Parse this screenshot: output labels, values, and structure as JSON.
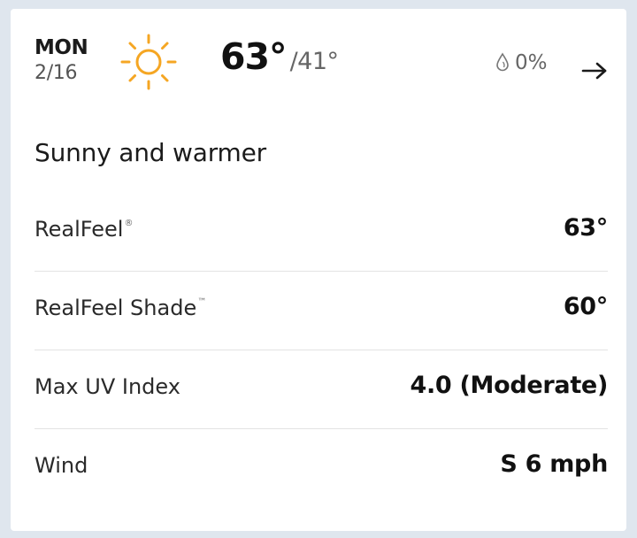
{
  "forecast": {
    "day": "MON",
    "date": "2/16",
    "icon": "sun-icon",
    "high": "63°",
    "low": "/41°",
    "precip_chance": "0%",
    "phrase": "Sunny and warmer"
  },
  "details": [
    {
      "label": "RealFeel",
      "mark": "®",
      "value": "63°"
    },
    {
      "label": "RealFeel Shade",
      "mark": "™",
      "value": "60°"
    },
    {
      "label": "Max UV Index",
      "mark": "",
      "value": "4.0 (Moderate)"
    },
    {
      "label": "Wind",
      "mark": "",
      "value": "S 6 mph"
    }
  ],
  "colors": {
    "sun": "#f5a623",
    "background": "#dfe6ee",
    "card": "#ffffff",
    "divider": "#e3e3e3"
  }
}
